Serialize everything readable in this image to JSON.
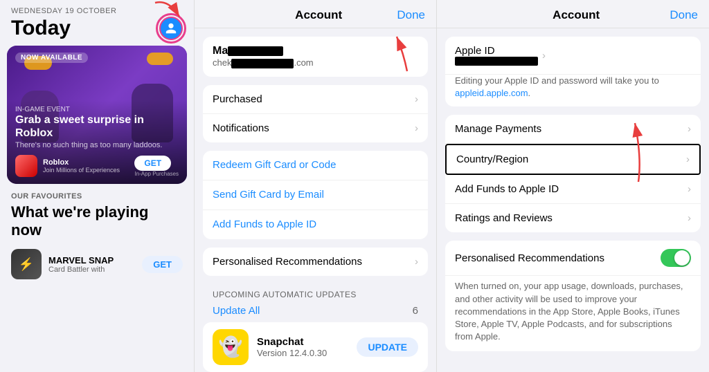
{
  "left": {
    "date": "WEDNESDAY 19 OCTOBER",
    "title": "Today",
    "now_available": "NOW AVAILABLE",
    "in_game_event": "IN-GAME EVENT",
    "card_title": "Grab a sweet surprise in Roblox",
    "card_subtitle": "There's no such thing as too many laddoos.",
    "app_name": "Roblox",
    "app_desc": "Join Millions of Experiences",
    "get_label": "GET",
    "in_app": "In-App Purchases",
    "our_favs": "OUR FAVOURITES",
    "favs_title": "What we're playing now",
    "favs_app_name": "MARVEL SNAP",
    "favs_app_desc": "Card Battler with",
    "favs_get": "GET"
  },
  "middle": {
    "header_title": "Account",
    "done_label": "Done",
    "account_name_visible": "Ma",
    "account_email_visible": "chek",
    "account_email_end": ".com",
    "purchased": "Purchased",
    "notifications": "Notifications",
    "redeem": "Redeem Gift Card or Code",
    "send_card": "Send Gift Card by Email",
    "add_funds": "Add Funds to Apple ID",
    "personalised_recs": "Personalised Recommendations",
    "upcoming_label": "UPCOMING AUTOMATIC UPDATES",
    "update_all": "Update All",
    "update_count": "6",
    "snapchat_name": "Snapchat",
    "snapchat_version": "Version 12.4.0.30",
    "update_btn": "UPDATE"
  },
  "right": {
    "header_title": "Account",
    "done_label": "Done",
    "apple_id_label": "Apple ID",
    "apple_id_desc1": "Editing your Apple ID and password will take you to",
    "apple_id_link": "appleid.apple.com",
    "apple_id_desc2": ".",
    "manage_payments": "Manage Payments",
    "country_region": "Country/Region",
    "add_funds": "Add Funds to Apple ID",
    "ratings_reviews": "Ratings and Reviews",
    "personalised_recs": "Personalised Recommendations",
    "personalised_desc": "When turned on, your app usage, downloads, purchases, and other activity will be used to improve your recommendations in the App Store, Apple Books, iTunes Store, Apple TV, Apple Podcasts, and for subscriptions from Apple."
  }
}
